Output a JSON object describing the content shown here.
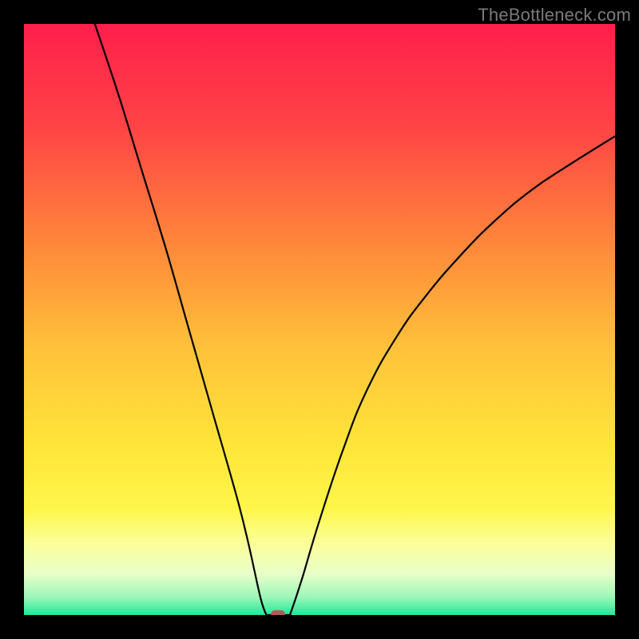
{
  "watermark": "TheBottleneck.com",
  "colors": {
    "bg": "#000000",
    "gradient_stops": [
      {
        "offset": 0.0,
        "color": "#ff1f4c"
      },
      {
        "offset": 0.18,
        "color": "#ff4545"
      },
      {
        "offset": 0.38,
        "color": "#ff8a3a"
      },
      {
        "offset": 0.55,
        "color": "#ffc23a"
      },
      {
        "offset": 0.72,
        "color": "#ffe63a"
      },
      {
        "offset": 0.82,
        "color": "#fff64a"
      },
      {
        "offset": 0.88,
        "color": "#fbff9a"
      },
      {
        "offset": 0.93,
        "color": "#e9ffc9"
      },
      {
        "offset": 0.97,
        "color": "#9cf7b8"
      },
      {
        "offset": 1.0,
        "color": "#1ee89a"
      }
    ],
    "curve": "#000000",
    "marker": "#b35a55"
  },
  "chart_data": {
    "type": "line",
    "title": "",
    "xlabel": "",
    "ylabel": "",
    "xlim": [
      0,
      100
    ],
    "ylim": [
      0,
      100
    ],
    "optimum_x": 42,
    "left_curve": [
      {
        "x": 12,
        "y": 100
      },
      {
        "x": 16,
        "y": 88
      },
      {
        "x": 20,
        "y": 75
      },
      {
        "x": 24,
        "y": 62
      },
      {
        "x": 28,
        "y": 48
      },
      {
        "x": 32,
        "y": 34
      },
      {
        "x": 36,
        "y": 20
      },
      {
        "x": 38,
        "y": 12
      },
      {
        "x": 40,
        "y": 3
      },
      {
        "x": 41,
        "y": 0
      }
    ],
    "flat": [
      {
        "x": 41,
        "y": 0
      },
      {
        "x": 45,
        "y": 0
      }
    ],
    "right_curve": [
      {
        "x": 45,
        "y": 0
      },
      {
        "x": 47,
        "y": 6
      },
      {
        "x": 50,
        "y": 16
      },
      {
        "x": 54,
        "y": 28
      },
      {
        "x": 58,
        "y": 38
      },
      {
        "x": 63,
        "y": 47
      },
      {
        "x": 68,
        "y": 54
      },
      {
        "x": 74,
        "y": 61
      },
      {
        "x": 80,
        "y": 67
      },
      {
        "x": 86,
        "y": 72
      },
      {
        "x": 92,
        "y": 76
      },
      {
        "x": 100,
        "y": 81
      }
    ],
    "marker": {
      "x": 43,
      "y": 0
    }
  }
}
